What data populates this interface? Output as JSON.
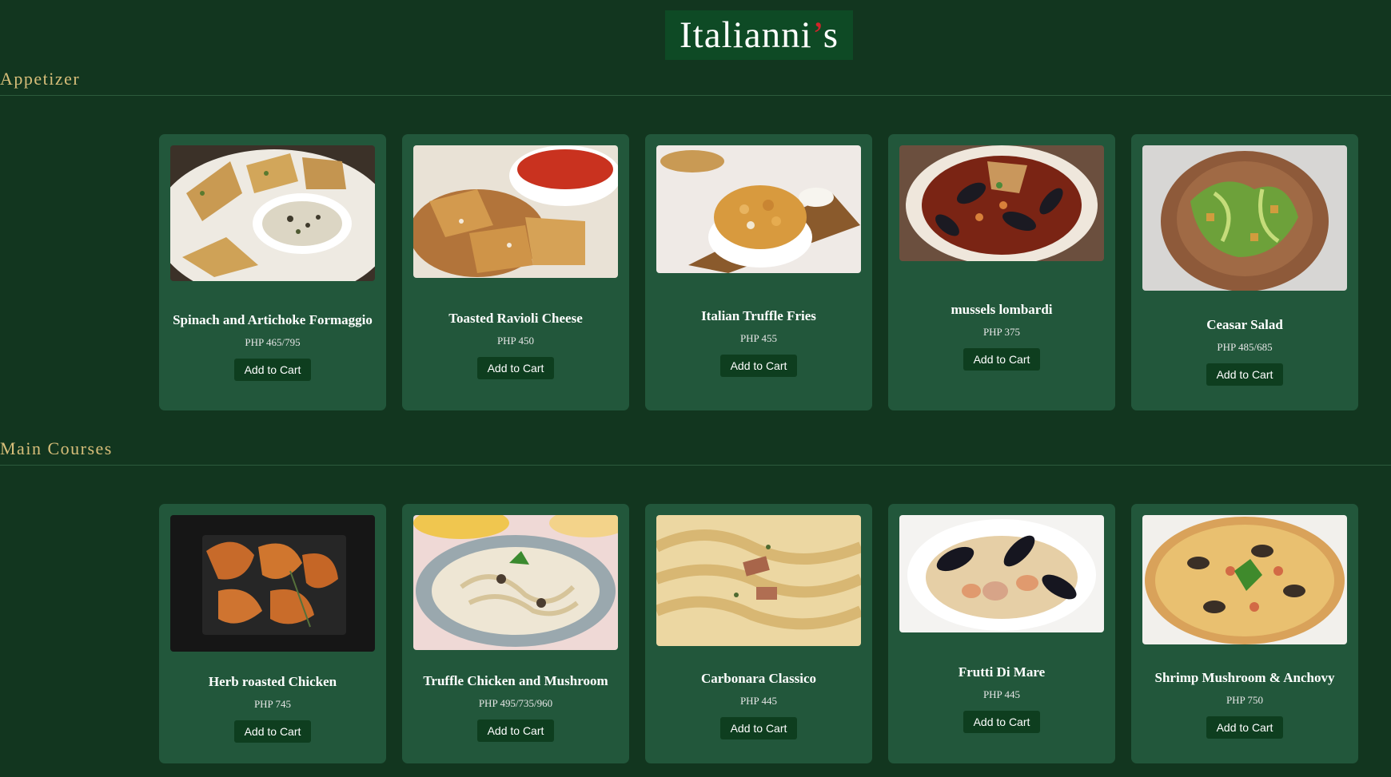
{
  "header": {
    "brand_main": "Italianni",
    "brand_accent": "’",
    "brand_tail": "s"
  },
  "sections": [
    {
      "title": "Appetizer",
      "items": [
        {
          "name": "Spinach and Artichoke Formaggio",
          "price": "PHP 465/795",
          "button": "Add to Cart",
          "image": "spinach-artichoke-dip-photo"
        },
        {
          "name": "Toasted Ravioli Cheese",
          "price": "PHP 450",
          "button": "Add to Cart",
          "image": "toasted-ravioli-photo"
        },
        {
          "name": "Italian Truffle Fries",
          "price": "PHP 455",
          "button": "Add to Cart",
          "image": "truffle-fries-photo"
        },
        {
          "name": "mussels lombardi",
          "price": "PHP 375",
          "button": "Add to Cart",
          "image": "mussels-photo"
        },
        {
          "name": "Ceasar Salad",
          "price": "PHP 485/685",
          "button": "Add to Cart",
          "image": "caesar-salad-photo"
        }
      ]
    },
    {
      "title": "Main Courses",
      "items": [
        {
          "name": "Herb roasted Chicken",
          "price": "PHP 745",
          "button": "Add to Cart",
          "image": "roasted-chicken-photo"
        },
        {
          "name": "Truffle Chicken and Mushroom",
          "price": "PHP 495/735/960",
          "button": "Add to Cart",
          "image": "truffle-pasta-photo"
        },
        {
          "name": "Carbonara Classico",
          "price": "PHP 445",
          "button": "Add to Cart",
          "image": "carbonara-photo"
        },
        {
          "name": "Frutti Di Mare",
          "price": "PHP 445",
          "button": "Add to Cart",
          "image": "seafood-pasta-photo"
        },
        {
          "name": "Shrimp Mushroom & Anchovy",
          "price": "PHP 750",
          "button": "Add to Cart",
          "image": "pizza-photo"
        }
      ]
    }
  ]
}
